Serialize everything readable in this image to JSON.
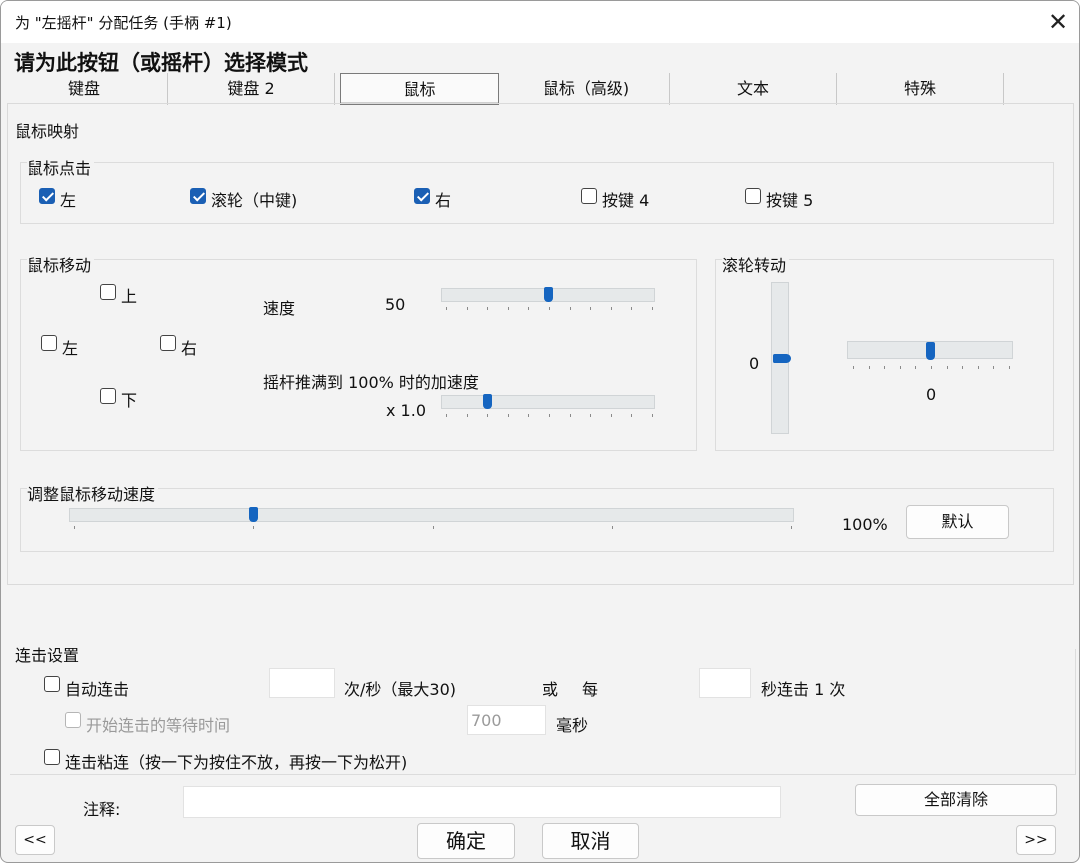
{
  "window": {
    "title": "为 \"左摇杆\" 分配任务 (手柄 #1)",
    "close_glyph": "✕"
  },
  "heading": "请为此按钮（或摇杆）选择模式",
  "tabs": [
    {
      "label": "键盘",
      "selected": false
    },
    {
      "label": "键盘 2",
      "selected": false
    },
    {
      "label": "鼠标",
      "selected": true
    },
    {
      "label": "鼠标（高级)",
      "selected": false
    },
    {
      "label": "文本",
      "selected": false
    },
    {
      "label": "特殊",
      "selected": false
    }
  ],
  "mouse_mapping": {
    "title": "鼠标映射",
    "click": {
      "title": "鼠标点击",
      "left": {
        "label": "左",
        "checked": true
      },
      "wheel": {
        "label": "滚轮（中键)",
        "checked": true
      },
      "right": {
        "label": "右",
        "checked": true
      },
      "btn4": {
        "label": "按键 4",
        "checked": false
      },
      "btn5": {
        "label": "按键 5",
        "checked": false
      }
    },
    "move": {
      "title": "鼠标移动",
      "up": {
        "label": "上",
        "checked": false
      },
      "left": {
        "label": "左",
        "checked": false
      },
      "right": {
        "label": "右",
        "checked": false
      },
      "down": {
        "label": "下",
        "checked": false
      },
      "speed_label": "速度",
      "speed_value": "50",
      "speed_fraction": 0.5,
      "accel_label": "摇杆推满到 100% 时的加速度",
      "accel_value": "x 1.0",
      "accel_fraction": 0.2
    },
    "wheel": {
      "title": "滚轮转动",
      "vertical_value": "0",
      "vertical_fraction": 0.5,
      "horizontal_value": "0",
      "horizontal_fraction": 0.5
    },
    "adjust": {
      "title": "调整鼠标移动速度",
      "percent": "100%",
      "fraction": 0.25,
      "default_button": "默认"
    }
  },
  "turbo": {
    "title": "连击设置",
    "auto": {
      "label": "自动连击",
      "checked": false
    },
    "rate_value": "",
    "rate_suffix": "次/秒（最大30)",
    "or_label": "或",
    "every_label": "每",
    "interval_value": "",
    "interval_suffix": "秒连击 1 次",
    "delay": {
      "label": "开始连击的等待时间",
      "checked": false,
      "value": "700",
      "unit": "毫秒"
    },
    "sticky": {
      "label": "连击粘连（按一下为按住不放，再按一下为松开)",
      "checked": false
    }
  },
  "footer": {
    "note_label": "注释:",
    "note_value": "",
    "clear_all": "全部清除",
    "prev": "<<",
    "ok": "确定",
    "cancel": "取消",
    "next": ">>"
  },
  "colors": {
    "accent": "#1565c0",
    "window_bg": "#f3f3f3",
    "titlebar_bg": "#ffffff"
  }
}
